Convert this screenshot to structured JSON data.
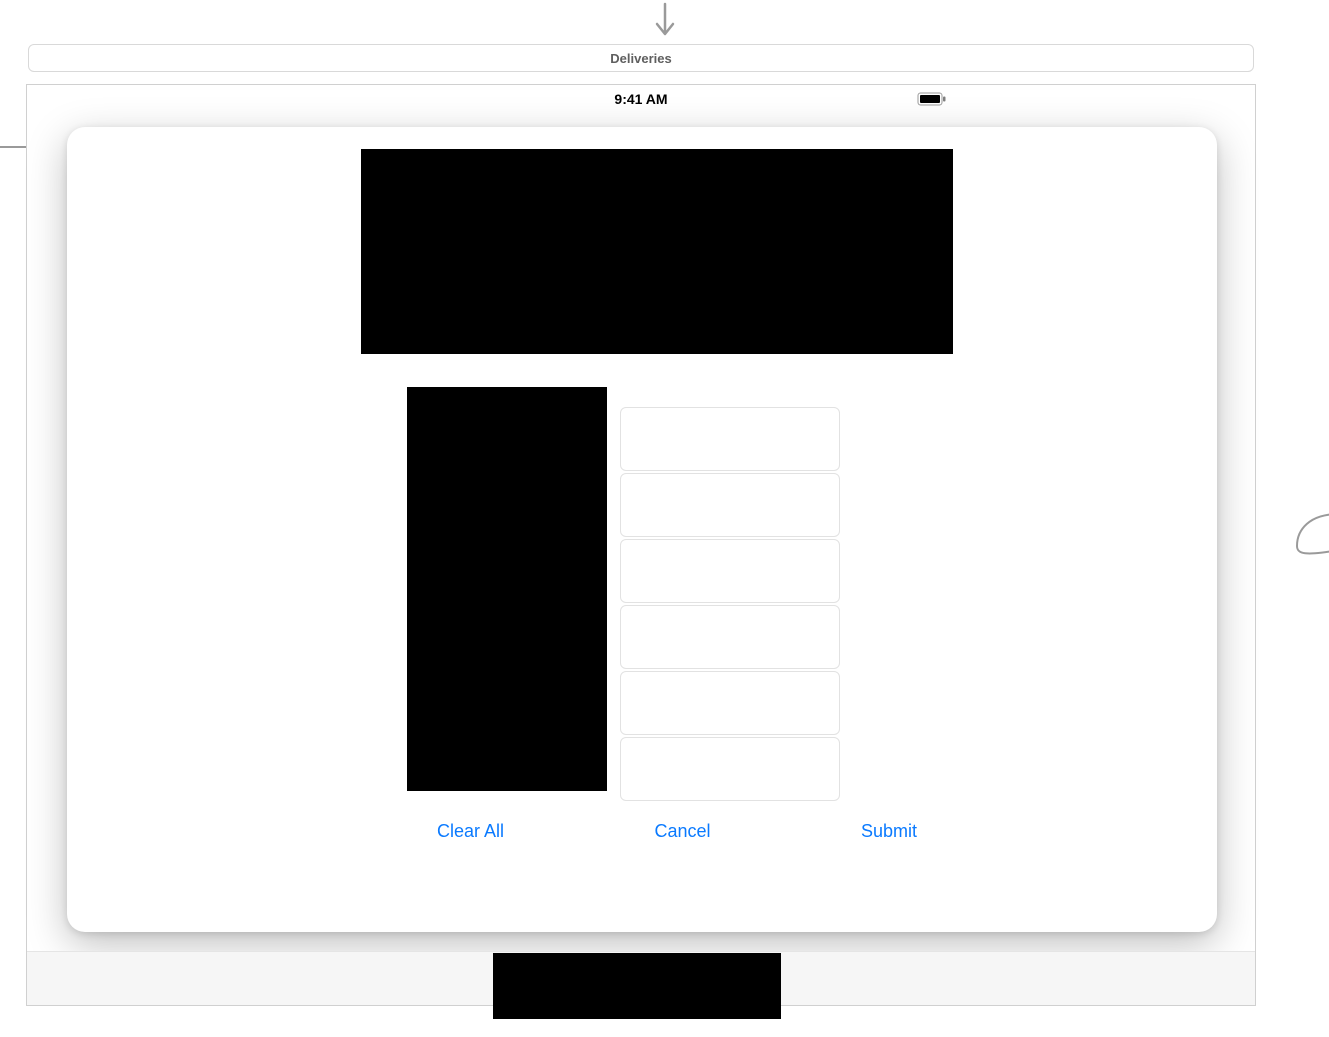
{
  "annotations": {
    "top_arrow": "↓"
  },
  "tab": {
    "label": "Deliveries"
  },
  "statusbar": {
    "time": "9:41 AM"
  },
  "form": {
    "fields": [
      {
        "value": ""
      },
      {
        "value": ""
      },
      {
        "value": ""
      },
      {
        "value": ""
      },
      {
        "value": ""
      },
      {
        "value": ""
      }
    ]
  },
  "actions": {
    "clear_all": "Clear All",
    "cancel": "Cancel",
    "submit": "Submit"
  }
}
